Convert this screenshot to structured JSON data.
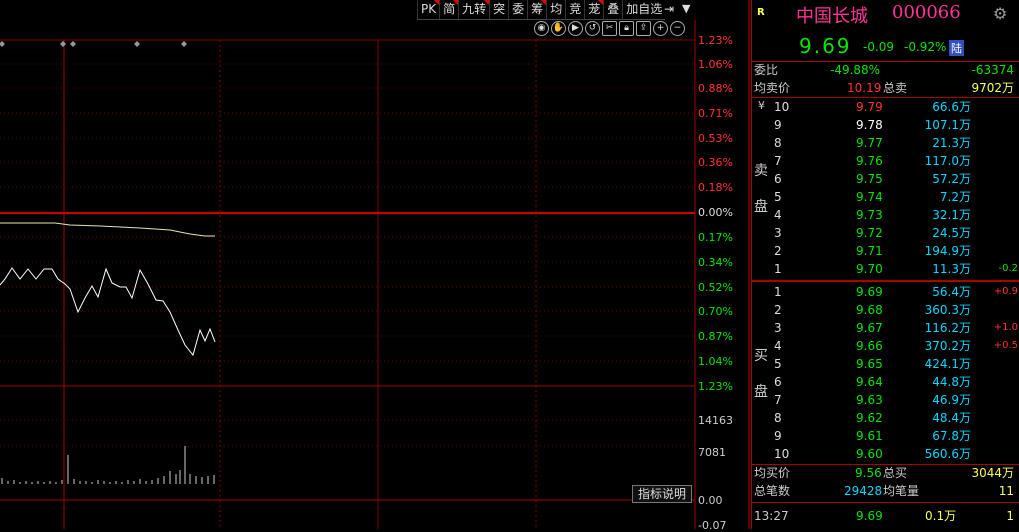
{
  "toolbar": {
    "items": [
      "PK",
      "简",
      "九转",
      "突",
      "委",
      "筹",
      "均",
      "竞",
      "茏",
      "叠",
      "加自选"
    ],
    "flagged": [
      true,
      true,
      true,
      false,
      false,
      true,
      false,
      false,
      true,
      false,
      false
    ]
  },
  "chart": {
    "price_axis": [
      "1.23%",
      "1.06%",
      "0.88%",
      "0.71%",
      "0.53%",
      "0.36%",
      "0.18%",
      "0.00%",
      "0.17%",
      "0.34%",
      "0.52%",
      "0.70%",
      "0.87%",
      "1.04%",
      "1.23%"
    ],
    "volume_axis": [
      "14163",
      "7081",
      "0.00",
      "-0.07"
    ],
    "indicator_button": "指标说明"
  },
  "stock": {
    "marker": "R",
    "name": "中国长城",
    "code": "000066",
    "price": "9.69",
    "change": "-0.09",
    "change_pct": "-0.92%",
    "board": "陆"
  },
  "summary_top": {
    "weibi_label": "委比",
    "weibi_pct": "-49.88%",
    "weibi_diff": "-63374",
    "avg_sell_label": "均卖价",
    "avg_sell": "10.19",
    "total_sell_label": "总卖",
    "total_sell": "9702万"
  },
  "sell_side_label": [
    "卖",
    "盘"
  ],
  "sell_orders": [
    {
      "level": "10",
      "price": "9.79",
      "vol": "66.6万",
      "chg": "",
      "pc": "red"
    },
    {
      "level": "9",
      "price": "9.78",
      "vol": "107.1万",
      "chg": "",
      "pc": "white"
    },
    {
      "level": "8",
      "price": "9.77",
      "vol": "21.3万",
      "chg": "",
      "pc": "green"
    },
    {
      "level": "7",
      "price": "9.76",
      "vol": "117.0万",
      "chg": "",
      "pc": "green"
    },
    {
      "level": "6",
      "price": "9.75",
      "vol": "57.2万",
      "chg": "",
      "pc": "green"
    },
    {
      "level": "5",
      "price": "9.74",
      "vol": "7.2万",
      "chg": "",
      "pc": "green"
    },
    {
      "level": "4",
      "price": "9.73",
      "vol": "32.1万",
      "chg": "",
      "pc": "green"
    },
    {
      "level": "3",
      "price": "9.72",
      "vol": "24.5万",
      "chg": "",
      "pc": "green"
    },
    {
      "level": "2",
      "price": "9.71",
      "vol": "194.9万",
      "chg": "",
      "pc": "green"
    },
    {
      "level": "1",
      "price": "9.70",
      "vol": "11.3万",
      "chg": "-0.2",
      "pc": "green"
    }
  ],
  "buy_side_label": [
    "买",
    "盘"
  ],
  "buy_orders": [
    {
      "level": "1",
      "price": "9.69",
      "vol": "56.4万",
      "chg": "+0.9",
      "pc": "green"
    },
    {
      "level": "2",
      "price": "9.68",
      "vol": "360.3万",
      "chg": "",
      "pc": "green"
    },
    {
      "level": "3",
      "price": "9.67",
      "vol": "116.2万",
      "chg": "+1.0",
      "pc": "green"
    },
    {
      "level": "4",
      "price": "9.66",
      "vol": "370.2万",
      "chg": "+0.5",
      "pc": "green"
    },
    {
      "level": "5",
      "price": "9.65",
      "vol": "424.1万",
      "chg": "",
      "pc": "green"
    },
    {
      "level": "6",
      "price": "9.64",
      "vol": "44.8万",
      "chg": "",
      "pc": "green"
    },
    {
      "level": "7",
      "price": "9.63",
      "vol": "46.9万",
      "chg": "",
      "pc": "green"
    },
    {
      "level": "8",
      "price": "9.62",
      "vol": "48.4万",
      "chg": "",
      "pc": "green"
    },
    {
      "level": "9",
      "price": "9.61",
      "vol": "67.8万",
      "chg": "",
      "pc": "green"
    },
    {
      "level": "10",
      "price": "9.60",
      "vol": "560.6万",
      "chg": "",
      "pc": "green"
    }
  ],
  "summary_bottom": {
    "avg_buy_label": "均买价",
    "avg_buy": "9.56",
    "total_buy_label": "总买",
    "total_buy": "3044万",
    "trades_label": "总笔数",
    "trades": "29428",
    "avg_vol_label": "均笔量",
    "avg_vol": "11"
  },
  "last_tick": {
    "time": "13:27",
    "price": "9.69",
    "vol": "0.1万",
    "count": "1"
  },
  "yen": "¥"
}
